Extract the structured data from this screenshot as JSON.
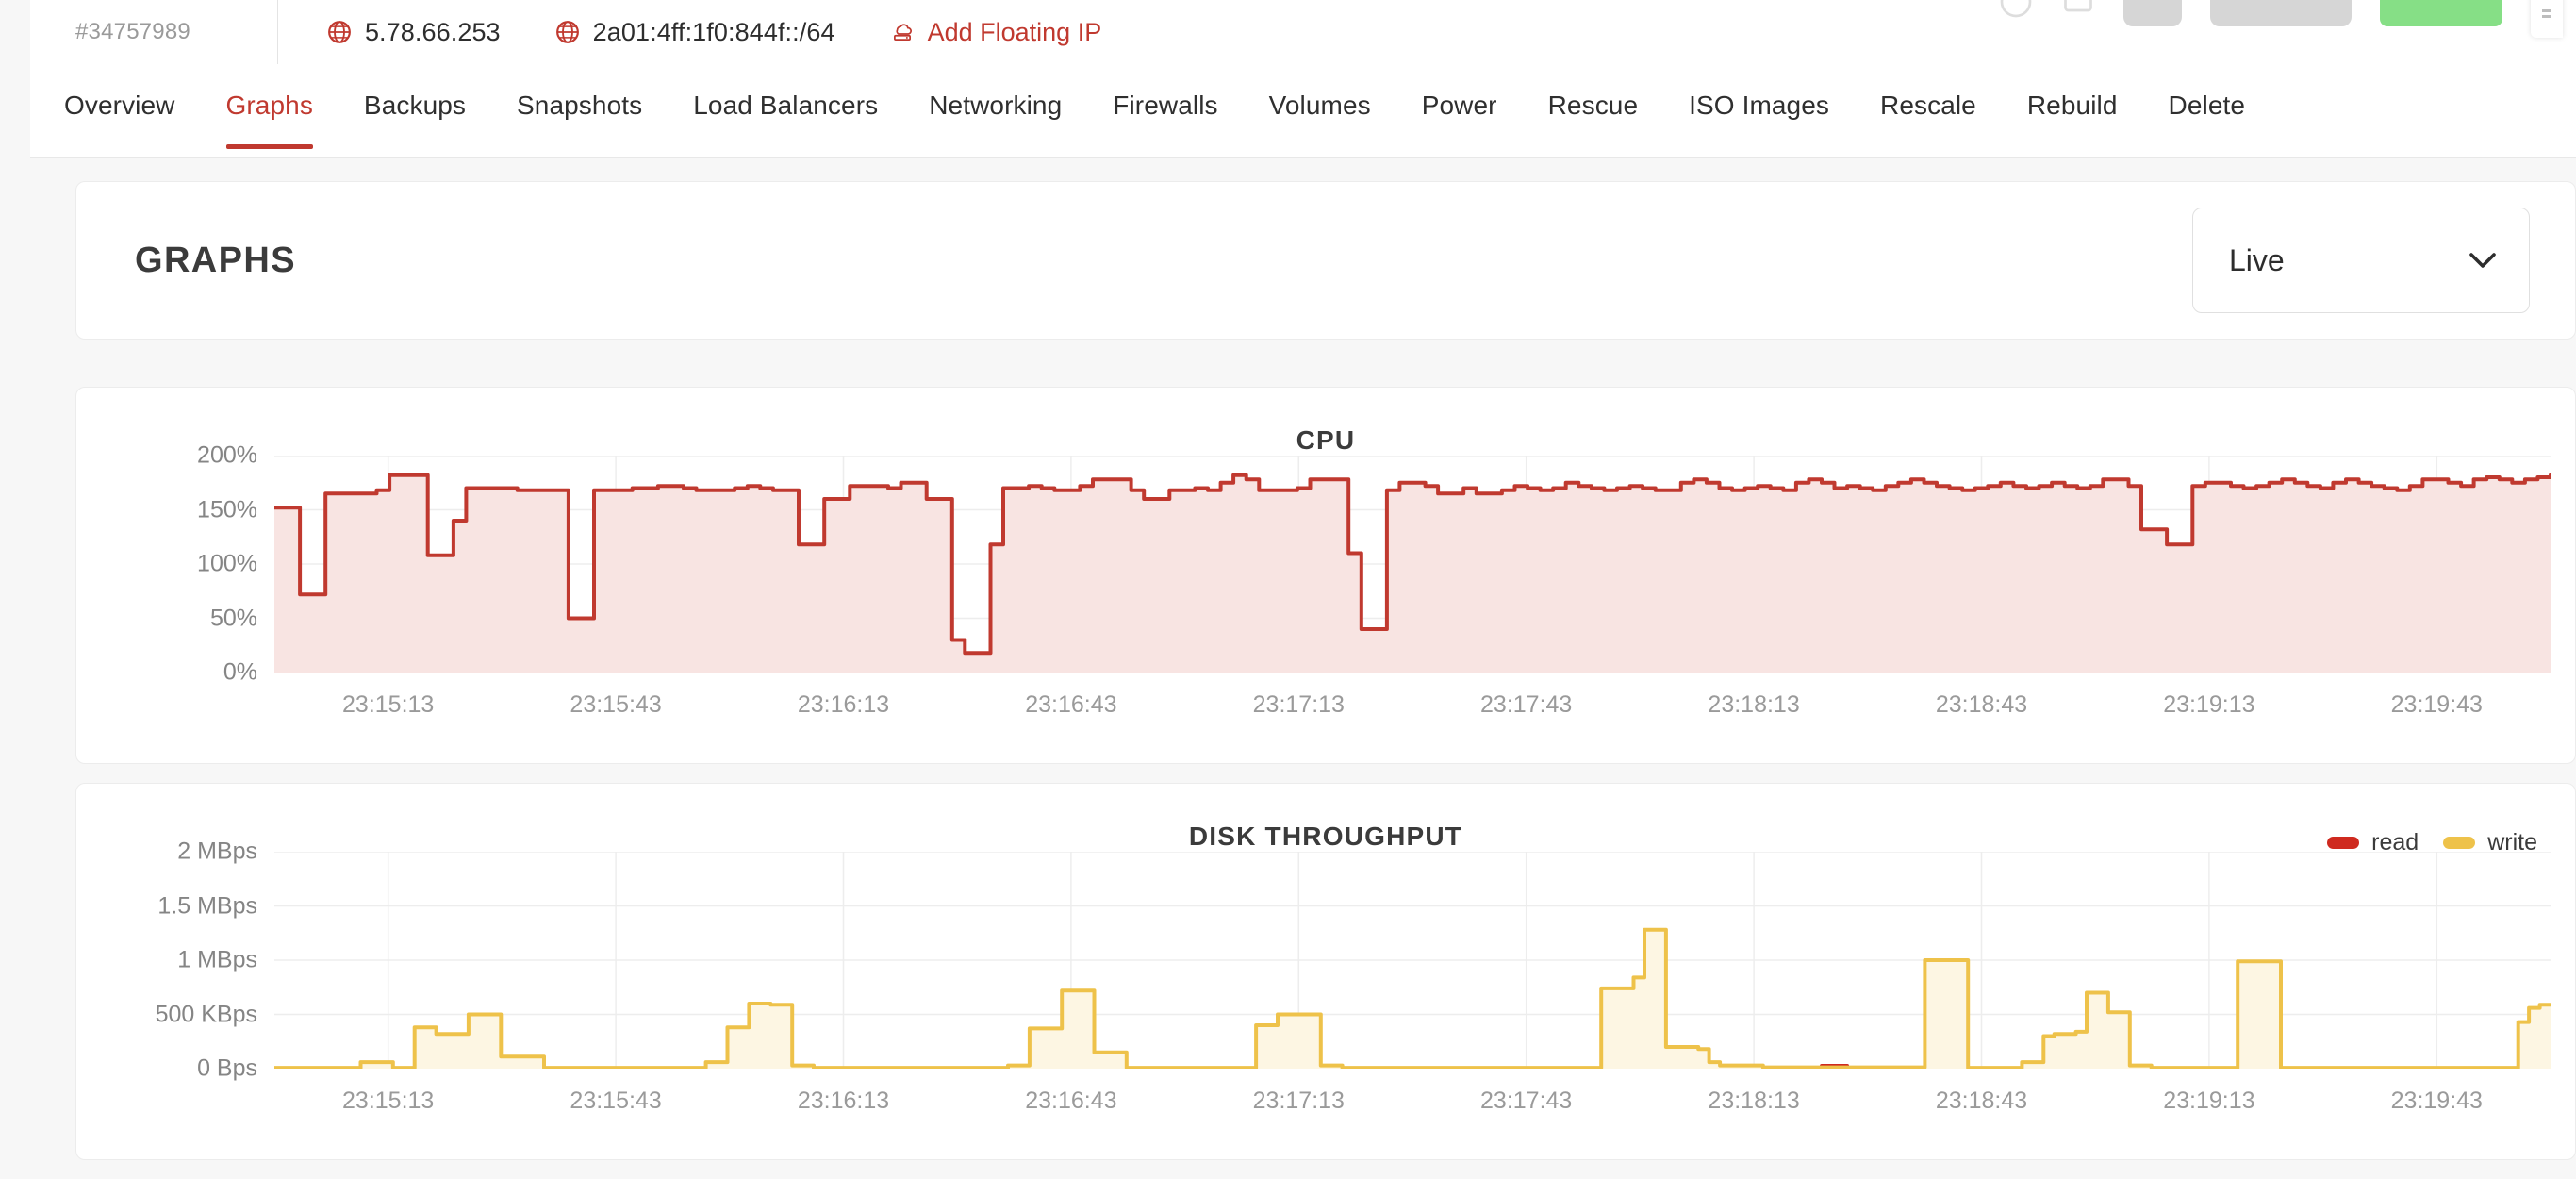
{
  "topbar": {
    "server_id": "#34757989",
    "ips": [
      {
        "icon": "globe-icon",
        "value": "5.78.66.253"
      },
      {
        "icon": "globe-icon",
        "value": "2a01:4ff:1f0:844f::/64"
      }
    ],
    "add_floating_ip": "Add Floating IP",
    "accent_color": "#c0392f"
  },
  "nav": {
    "tabs": [
      {
        "label": "Overview",
        "active": false
      },
      {
        "label": "Graphs",
        "active": true
      },
      {
        "label": "Backups",
        "active": false
      },
      {
        "label": "Snapshots",
        "active": false
      },
      {
        "label": "Load Balancers",
        "active": false
      },
      {
        "label": "Networking",
        "active": false
      },
      {
        "label": "Firewalls",
        "active": false
      },
      {
        "label": "Volumes",
        "active": false
      },
      {
        "label": "Power",
        "active": false
      },
      {
        "label": "Rescue",
        "active": false
      },
      {
        "label": "ISO Images",
        "active": false
      },
      {
        "label": "Rescale",
        "active": false
      },
      {
        "label": "Rebuild",
        "active": false
      },
      {
        "label": "Delete",
        "active": false
      }
    ]
  },
  "header": {
    "title": "GRAPHS",
    "range_value": "Live"
  },
  "chart_data": [
    {
      "type": "area",
      "title": "CPU",
      "xlabel": "",
      "ylabel": "",
      "ylim": [
        0,
        200
      ],
      "ytick_labels": [
        "0%",
        "50%",
        "100%",
        "150%",
        "200%"
      ],
      "yticks": [
        0,
        50,
        100,
        150,
        200
      ],
      "xtick_labels": [
        "23:15:13",
        "23:15:43",
        "23:16:13",
        "23:16:43",
        "23:17:13",
        "23:17:43",
        "23:18:13",
        "23:18:43",
        "23:19:13",
        "23:19:43"
      ],
      "grid": true,
      "legend": null,
      "series": [
        {
          "name": "cpu",
          "color": "#c0392f",
          "fill": "#f8e4e2",
          "values": [
            152,
            152,
            72,
            72,
            165,
            165,
            165,
            165,
            168,
            182,
            182,
            182,
            108,
            108,
            140,
            170,
            170,
            170,
            170,
            168,
            168,
            168,
            168,
            50,
            50,
            168,
            168,
            168,
            170,
            170,
            172,
            172,
            170,
            168,
            168,
            168,
            170,
            172,
            170,
            168,
            168,
            118,
            118,
            160,
            160,
            172,
            172,
            172,
            170,
            175,
            175,
            160,
            160,
            30,
            18,
            18,
            118,
            170,
            170,
            172,
            170,
            168,
            168,
            172,
            178,
            178,
            178,
            168,
            160,
            160,
            168,
            168,
            170,
            168,
            175,
            182,
            178,
            168,
            168,
            168,
            170,
            178,
            178,
            178,
            110,
            40,
            40,
            168,
            175,
            175,
            172,
            165,
            165,
            170,
            165,
            165,
            168,
            172,
            170,
            168,
            170,
            175,
            172,
            170,
            168,
            170,
            172,
            170,
            168,
            168,
            175,
            178,
            175,
            170,
            168,
            170,
            172,
            170,
            168,
            175,
            178,
            175,
            170,
            172,
            170,
            168,
            172,
            175,
            178,
            175,
            172,
            170,
            168,
            170,
            172,
            175,
            172,
            170,
            172,
            175,
            172,
            170,
            172,
            178,
            178,
            172,
            132,
            132,
            118,
            118,
            172,
            175,
            175,
            172,
            170,
            172,
            175,
            178,
            175,
            172,
            170,
            175,
            178,
            175,
            172,
            170,
            168,
            172,
            178,
            178,
            175,
            172,
            178,
            180,
            178,
            175,
            178,
            180,
            182
          ]
        }
      ]
    },
    {
      "type": "area",
      "title": "DISK THROUGHPUT",
      "xlabel": "",
      "ylabel": "",
      "ylim": [
        0,
        2000
      ],
      "ytick_labels": [
        "0 Bps",
        "500 KBps",
        "1 MBps",
        "1.5 MBps",
        "2 MBps"
      ],
      "yticks": [
        0,
        500,
        1000,
        1500,
        2000
      ],
      "xtick_labels": [
        "23:15:13",
        "23:15:43",
        "23:16:13",
        "23:16:43",
        "23:17:13",
        "23:17:43",
        "23:18:13",
        "23:18:43",
        "23:19:13",
        "23:19:43"
      ],
      "grid": true,
      "legend": {
        "position": "top-right",
        "entries": [
          {
            "label": "read",
            "color": "#cf2a1f"
          },
          {
            "label": "write",
            "color": "#eec24a"
          }
        ]
      },
      "series": [
        {
          "name": "read",
          "color": "#cf2a1f",
          "fill": "#fbeae8",
          "values": [
            4,
            4,
            4,
            4,
            4,
            4,
            4,
            4,
            4,
            4,
            4,
            4,
            4,
            4,
            4,
            4,
            4,
            4,
            4,
            4,
            4,
            4,
            4,
            4,
            4,
            4,
            4,
            4,
            4,
            4,
            4,
            4,
            4,
            4,
            4,
            4,
            4,
            4,
            4,
            4,
            4,
            4,
            4,
            4,
            4,
            4,
            4,
            4,
            4,
            4,
            4,
            4,
            4,
            4,
            4,
            4,
            4,
            4,
            4,
            4,
            4,
            4,
            4,
            4,
            4,
            4,
            4,
            4,
            4,
            4,
            4,
            4,
            4,
            4,
            4,
            4,
            4,
            4,
            4,
            4,
            4,
            4,
            4,
            4,
            4,
            4,
            4,
            4,
            4,
            4,
            4,
            4,
            4,
            4,
            4,
            4,
            4,
            4,
            4,
            4,
            4,
            4,
            4,
            4,
            4,
            4,
            4,
            4,
            4,
            4,
            4,
            4,
            4,
            4,
            4,
            4,
            4,
            4,
            4,
            4,
            4,
            26,
            26,
            8,
            4,
            4,
            4,
            4,
            4,
            4,
            4,
            4,
            4,
            4,
            4,
            4,
            4,
            4,
            4,
            4,
            4,
            4,
            4,
            4,
            4,
            4,
            4,
            4,
            4,
            4,
            4,
            4,
            4,
            4,
            4,
            4,
            4,
            4,
            4,
            4,
            4,
            4,
            4,
            4,
            4,
            4,
            4,
            4,
            4,
            4,
            4,
            4,
            4,
            4,
            4,
            4,
            4,
            4,
            4
          ]
        },
        {
          "name": "write",
          "color": "#eec24a",
          "fill": "#fdf6e3",
          "values": [
            8,
            8,
            8,
            8,
            8,
            8,
            8,
            8,
            60,
            60,
            60,
            8,
            8,
            380,
            380,
            320,
            320,
            320,
            500,
            500,
            500,
            110,
            110,
            110,
            110,
            8,
            8,
            8,
            8,
            8,
            8,
            8,
            8,
            8,
            8,
            8,
            8,
            8,
            8,
            8,
            60,
            60,
            380,
            380,
            600,
            600,
            590,
            590,
            30,
            30,
            8,
            8,
            8,
            8,
            8,
            8,
            8,
            8,
            8,
            8,
            8,
            8,
            8,
            8,
            8,
            8,
            8,
            8,
            30,
            30,
            370,
            370,
            370,
            720,
            720,
            720,
            150,
            150,
            150,
            8,
            8,
            8,
            8,
            8,
            8,
            8,
            8,
            8,
            8,
            8,
            8,
            400,
            400,
            500,
            500,
            500,
            500,
            30,
            30,
            8,
            8,
            8,
            8,
            8,
            8,
            8,
            8,
            8,
            8,
            8,
            8,
            8,
            8,
            8,
            8,
            8,
            8,
            8,
            8,
            8,
            8,
            8,
            8,
            740,
            740,
            740,
            840,
            1280,
            1280,
            200,
            200,
            200,
            180,
            60,
            30,
            30,
            30,
            30,
            12,
            12,
            12,
            12,
            12,
            12,
            12,
            12,
            12,
            12,
            12,
            12,
            12,
            12,
            12,
            1000,
            1000,
            1000,
            1000,
            8,
            8,
            8,
            8,
            8,
            60,
            60,
            300,
            320,
            320,
            340,
            700,
            700,
            520,
            520,
            30,
            30,
            8,
            8,
            8,
            8,
            8,
            8,
            8,
            8,
            990,
            990,
            990,
            990,
            8,
            8,
            8,
            8,
            8,
            8,
            8,
            8,
            8,
            8,
            8,
            8,
            8,
            8,
            8,
            8,
            8,
            8,
            8,
            8,
            8,
            8,
            430,
            560,
            590,
            590
          ]
        }
      ]
    }
  ]
}
